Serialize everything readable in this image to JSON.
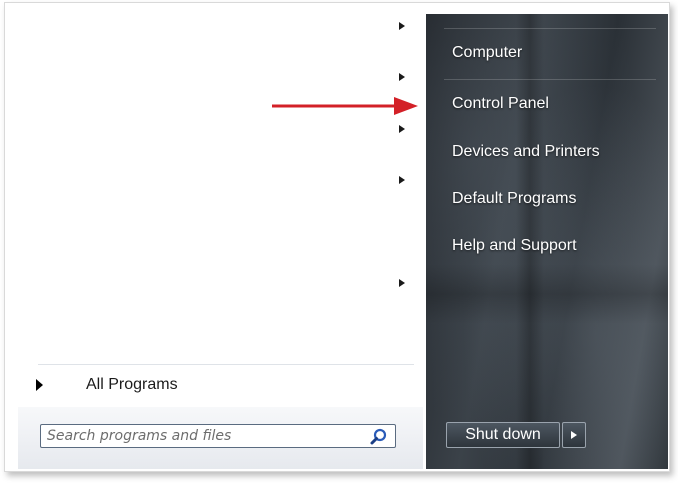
{
  "programs_pane": {
    "all_programs_label": "All Programs",
    "search": {
      "placeholder": "Search programs and files",
      "value": ""
    }
  },
  "places_pane": {
    "items": [
      {
        "label": "Computer"
      },
      {
        "label": "Control Panel"
      },
      {
        "label": "Devices and Printers"
      },
      {
        "label": "Default Programs"
      },
      {
        "label": "Help and Support"
      }
    ],
    "shutdown_label": "Shut down"
  },
  "icons": {
    "search": "magnifier-icon",
    "submenu": "chevron-right-icon",
    "annotation": "red-arrow-icon"
  },
  "colors": {
    "annotation_arrow": "#d32027",
    "places_pane_text": "#ffffff"
  }
}
